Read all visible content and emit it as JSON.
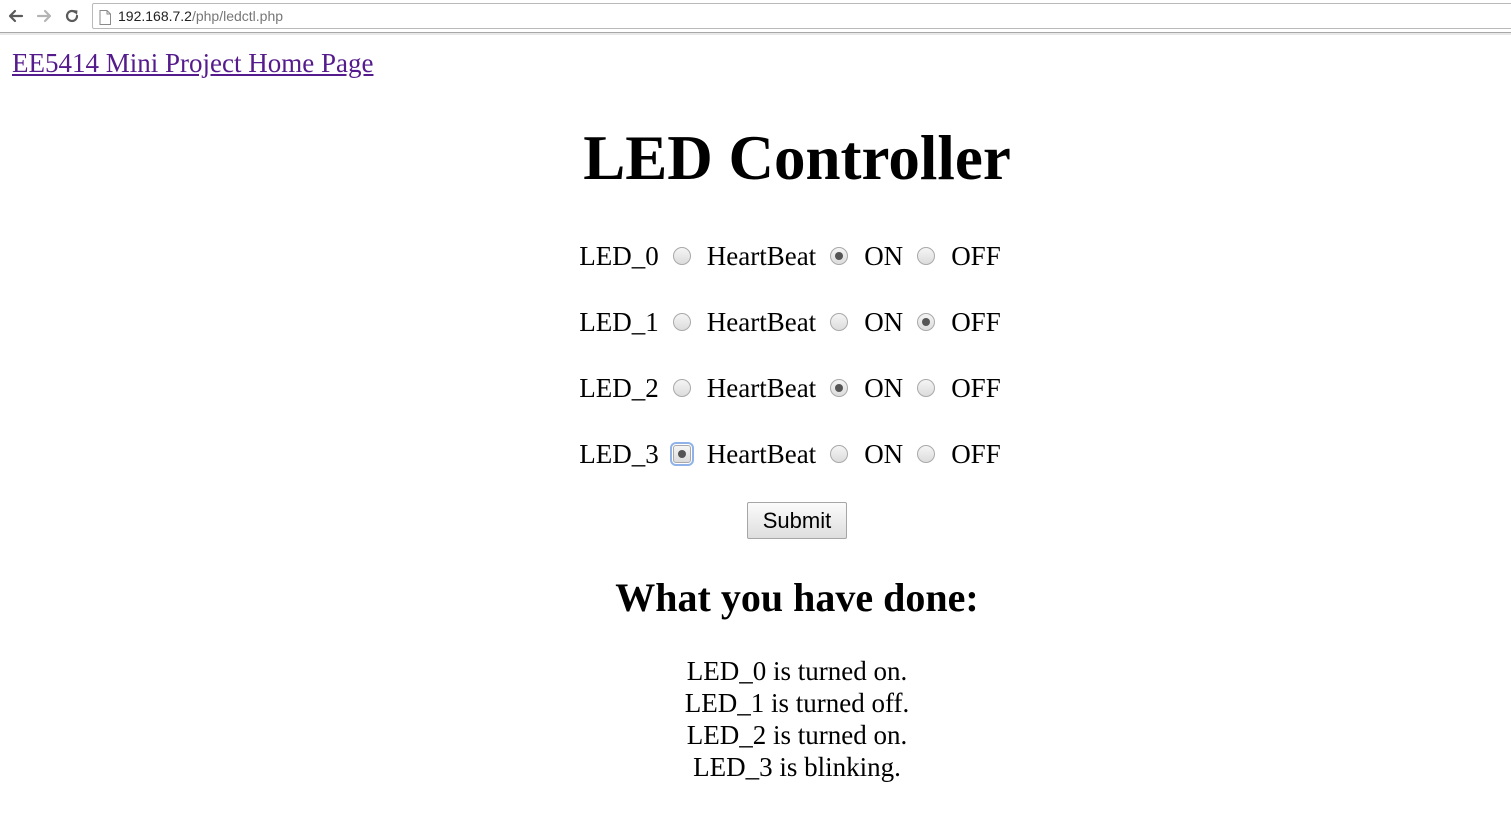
{
  "browser": {
    "url_host": "192.168.7.2",
    "url_path": "/php/ledctl.php",
    "icons": [
      "back-arrow-icon",
      "forward-arrow-icon",
      "reload-icon",
      "page-icon"
    ]
  },
  "home_link": "EE5414 Mini Project Home Page",
  "title": "LED Controller",
  "options": [
    "HeartBeat",
    "ON",
    "OFF"
  ],
  "leds": [
    {
      "name": "LED_0",
      "selected": "ON"
    },
    {
      "name": "LED_1",
      "selected": "OFF"
    },
    {
      "name": "LED_2",
      "selected": "ON"
    },
    {
      "name": "LED_3",
      "selected": "HeartBeat"
    }
  ],
  "submit_label": "Submit",
  "result": {
    "title": "What you have done:",
    "lines": [
      "LED_0 is turned on.",
      "LED_1 is turned off.",
      "LED_2 is turned on.",
      "LED_3 is blinking."
    ]
  },
  "colors": {
    "visited_link": "#551a8b",
    "focus_ring": "#8fb2e8"
  }
}
